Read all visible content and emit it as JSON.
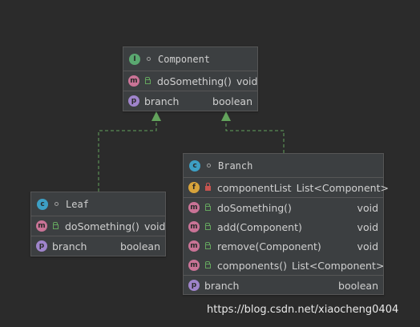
{
  "diagram": {
    "component": {
      "title": "Component",
      "method": {
        "name": "doSomething()",
        "type": "void"
      },
      "property": {
        "name": "branch",
        "type": "boolean"
      }
    },
    "leaf": {
      "title": "Leaf",
      "method": {
        "name": "doSomething()",
        "type": "void"
      },
      "property": {
        "name": "branch",
        "type": "boolean"
      }
    },
    "branch": {
      "title": "Branch",
      "field": {
        "name": "componentList",
        "type": "List<Component>"
      },
      "methods": [
        {
          "name": "doSomething()",
          "type": "void"
        },
        {
          "name": "add(Component)",
          "type": "void"
        },
        {
          "name": "remove(Component)",
          "type": "void"
        },
        {
          "name": "components()",
          "type": "List<Component>"
        }
      ],
      "property": {
        "name": "branch",
        "type": "boolean"
      }
    }
  },
  "icons": {
    "interface": "I",
    "class": "c",
    "method": "m",
    "property": "p",
    "field": "f"
  },
  "colors": {
    "background": "#2b2b2b",
    "node": "#3c3f41",
    "edge": "#63a35c",
    "interface_icon": "#5aa870",
    "class_icon": "#3d9fc4",
    "method_icon": "#c97396",
    "property_icon": "#9f84cb",
    "field_icon": "#d7a33b"
  },
  "watermark": "https://blog.csdn.net/xiaocheng0404"
}
